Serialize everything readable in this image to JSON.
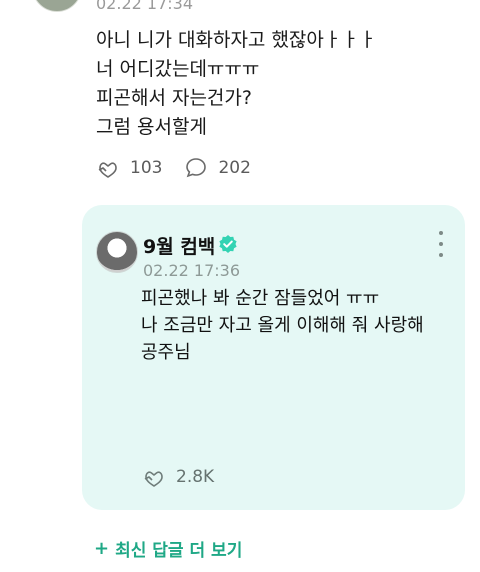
{
  "fan_comment": {
    "time": "02.22 17:34",
    "text": "아니 니가 대화하자고 했잖아ㅏㅏㅏ\n너 어디갔는데ㅠㅠㅠ\n피곤해서 자는건가?\n그럼 용서할게",
    "likes": "103",
    "comments": "202"
  },
  "artist_reply": {
    "name": "9월 컴백",
    "time": "02.22 17:36",
    "text": "피곤했나 봐 순간 잠들었어 ㅠㅠ\n나 조금만 자고 올게 이해해 줘 사랑해\n공주님",
    "likes": "2.8K"
  },
  "footer": {
    "more_replies_label": "최신 답글 더 보기"
  },
  "colors": {
    "card_bg": "#e5f8f5",
    "accent": "#1fa886",
    "verified": "#33d3b3"
  },
  "icons": [
    "heart-hand-icon",
    "comment-bubble-icon",
    "verified-badge-icon",
    "more-options-icon",
    "plus-icon"
  ]
}
